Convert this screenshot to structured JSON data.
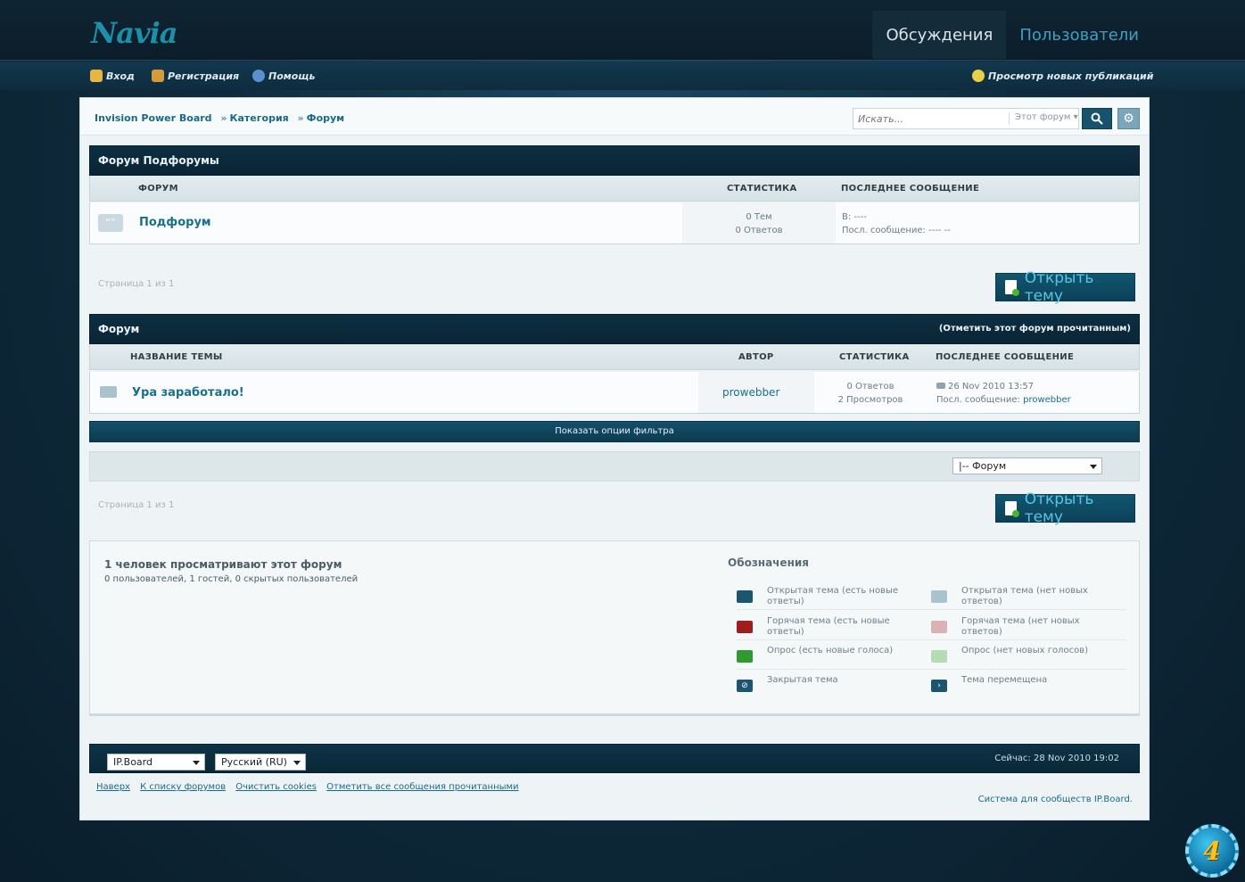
{
  "header": {
    "logo": "Navia",
    "nav": [
      {
        "label": "Обсуждения",
        "active": true
      },
      {
        "label": "Пользователи",
        "active": false
      }
    ]
  },
  "userbar": {
    "login": "Вход",
    "register": "Регистрация",
    "help": "Помощь",
    "new_content": "Просмотр новых публикаций"
  },
  "breadcrumb": [
    "Invision Power Board",
    "Категория",
    "Форум"
  ],
  "breadcrumb_sep": "»",
  "search": {
    "placeholder": "Искать...",
    "scope": "Этот форум"
  },
  "subforums": {
    "title": "Форум Подфорумы",
    "headers": {
      "forum": "ФОРУМ",
      "stats": "СТАТИСТИКА",
      "last": "ПОСЛЕДНЕЕ СООБЩЕНИЕ"
    },
    "rows": [
      {
        "name": "Подфорум",
        "topics": "0 Тем",
        "replies": "0 Ответов",
        "last_in": "В: ----",
        "last_by": "Посл. сообщение: ---- --"
      }
    ]
  },
  "pagination": "Страница 1 из 1",
  "start_topic": "Открыть тему",
  "topics": {
    "title": "Форум",
    "mark_read": "(Отметить этот форум прочитанным)",
    "headers": {
      "title": "НАЗВАНИЕ ТЕМЫ",
      "author": "АВТОР",
      "stats": "СТАТИСТИКА",
      "last": "ПОСЛЕДНЕЕ СООБЩЕНИЕ"
    },
    "rows": [
      {
        "title": "Ура заработало!",
        "author": "prowebber",
        "replies": "0 Ответов",
        "views": "2 Просмотров",
        "last_date": "26 Nov 2010 13:57",
        "last_by_label": "Посл. сообщение:",
        "last_by": "prowebber"
      }
    ]
  },
  "filter_bar": "Показать опции фильтра",
  "forum_jump": "|-- Форум",
  "active_users": {
    "title": "1 человек просматривают этот форум",
    "detail": "0 пользователей, 1 гостей, 0 скрытых пользователей"
  },
  "legend": {
    "title": "Обозначения",
    "items": [
      {
        "label": "Открытая тема (есть новые ответы)",
        "color": "#1b5570"
      },
      {
        "label": "Открытая тема (нет новых ответов)",
        "color": "#a9c2cc"
      },
      {
        "label": "Горячая тема (есть новые ответы)",
        "color": "#9e1e1e"
      },
      {
        "label": "Горячая тема (нет новых ответов)",
        "color": "#dbb2b2"
      },
      {
        "label": "Опрос (есть новые голоса)",
        "color": "#2f9a2f"
      },
      {
        "label": "Опрос (нет новых голосов)",
        "color": "#b7dcb3"
      },
      {
        "label": "Закрытая тема",
        "color": "#1b5570"
      },
      {
        "label": "Тема перемещена",
        "color": "#1b5570"
      }
    ]
  },
  "footer": {
    "skin": "IP.Board",
    "language": "Русский (RU)",
    "time": "Сейчас: 28 Nov 2010 19:02",
    "links": [
      "Наверх",
      "К списку форумов",
      "Очистить cookies",
      "Отметить все сообщения прочитанными"
    ],
    "copyright": "Система для сообществ IP.Board."
  },
  "badge": "4"
}
